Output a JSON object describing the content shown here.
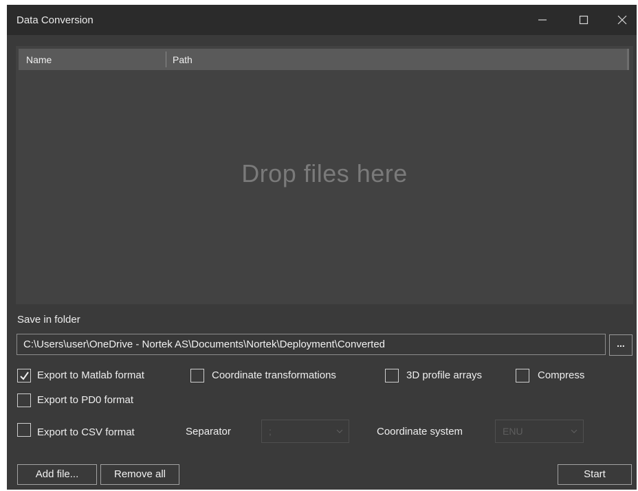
{
  "window": {
    "title": "Data Conversion"
  },
  "file_list": {
    "columns": [
      "Name",
      "Path"
    ],
    "drop_hint": "Drop files here"
  },
  "save_folder": {
    "label": "Save in folder",
    "path": "C:\\Users\\user\\OneDrive - Nortek AS\\Documents\\Nortek\\Deployment\\Converted",
    "browse_label": "..."
  },
  "options": {
    "matlab": {
      "label": "Export to Matlab format",
      "checked": true
    },
    "coord_transform": {
      "label": "Coordinate transformations",
      "checked": false
    },
    "profile_arrays": {
      "label": "3D profile arrays",
      "checked": false
    },
    "compress": {
      "label": "Compress",
      "checked": false
    },
    "pd0": {
      "label": "Export to PD0 format",
      "checked": false
    },
    "csv": {
      "label": "Export to CSV format",
      "checked": false
    }
  },
  "csv_settings": {
    "separator_label": "Separator",
    "separator_value": ";",
    "coord_system_label": "Coordinate system",
    "coord_system_value": "ENU"
  },
  "buttons": {
    "add_file": "Add file...",
    "remove_all": "Remove all",
    "start": "Start"
  },
  "colors": {
    "window_bg": "#3a3a3a",
    "titlebar_bg": "#2b2b2b",
    "list_bg": "#424242",
    "header_bg": "#5a5a5a",
    "drop_text": "#7a7a7a"
  }
}
